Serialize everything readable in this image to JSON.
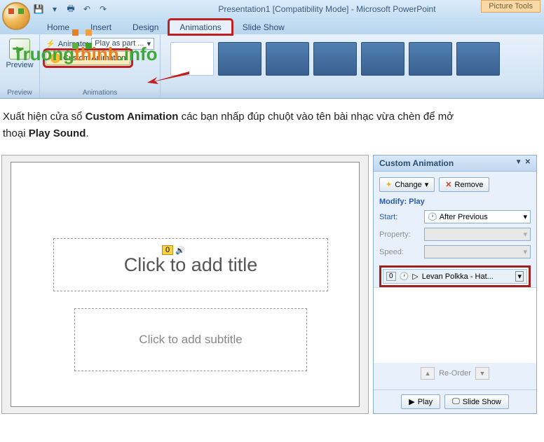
{
  "titlebar": {
    "title": "Presentation1 [Compatibility Mode] - Microsoft PowerPoint",
    "picture_tools": "Picture Tools"
  },
  "tabs": {
    "home": "Home",
    "insert": "Insert",
    "design": "Design",
    "animations": "Animations",
    "slideshow": "Slide Show"
  },
  "ribbon": {
    "preview": "Preview",
    "preview_label": "Preview",
    "animate_label": "Animate:",
    "animate_value": "Play as part ...",
    "custom_anim": "Custom Animation",
    "animations_label": "Animations"
  },
  "watermark": {
    "text1": "Truong",
    "text2": "thinh",
    "text3": ".info"
  },
  "article": {
    "line1_a": "Xuất hiện cửa sổ ",
    "line1_b": "Custom Animation",
    "line1_c": " các bạn nhấp đúp chuột vào tên bài nhạc vừa chèn để mở ",
    "line2_a": "thoại ",
    "line2_b": "Play Sound",
    "line2_c": "."
  },
  "slide": {
    "title_ph": "Click to add title",
    "subtitle_ph": "Click to add subtitle",
    "sound_seq": "0"
  },
  "ca": {
    "header": "Custom Animation",
    "change": "Change",
    "remove": "Remove",
    "modify": "Modify: Play",
    "start_label": "Start:",
    "start_value": "After Previous",
    "property_label": "Property:",
    "speed_label": "Speed:",
    "item_seq": "0",
    "item_name": "Levan Polkka - Hat...",
    "reorder": "Re-Order",
    "play": "Play",
    "slideshow": "Slide Show"
  }
}
